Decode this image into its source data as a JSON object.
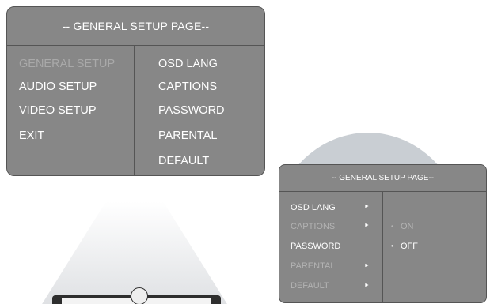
{
  "main_panel": {
    "title": "-- GENERAL SETUP PAGE--",
    "left_items": [
      {
        "label": "GENERAL SETUP"
      },
      {
        "label": "AUDIO SETUP"
      },
      {
        "label": "VIDEO SETUP"
      },
      {
        "label": "EXIT"
      }
    ],
    "right_items": [
      {
        "label": "OSD LANG"
      },
      {
        "label": "CAPTIONS"
      },
      {
        "label": "PASSWORD"
      },
      {
        "label": "PARENTAL"
      },
      {
        "label": "DEFAULT"
      }
    ]
  },
  "sub_panel": {
    "title": "-- GENERAL SETUP PAGE--",
    "items": [
      {
        "label": "OSD LANG",
        "arrow": "►"
      },
      {
        "label": "CAPTIONS",
        "arrow": "►"
      },
      {
        "label": "PASSWORD",
        "arrow": ""
      },
      {
        "label": "PARENTAL",
        "arrow": "►"
      },
      {
        "label": "DEFAULT",
        "arrow": "►"
      }
    ],
    "options": [
      {
        "bullet": "•",
        "label": "ON"
      },
      {
        "bullet": "•",
        "label": "OFF"
      }
    ]
  },
  "colors": {
    "panel_bg": "#878787",
    "panel_border": "#555555",
    "text": "#ffffff",
    "text_dim": "#a9a9a9"
  }
}
